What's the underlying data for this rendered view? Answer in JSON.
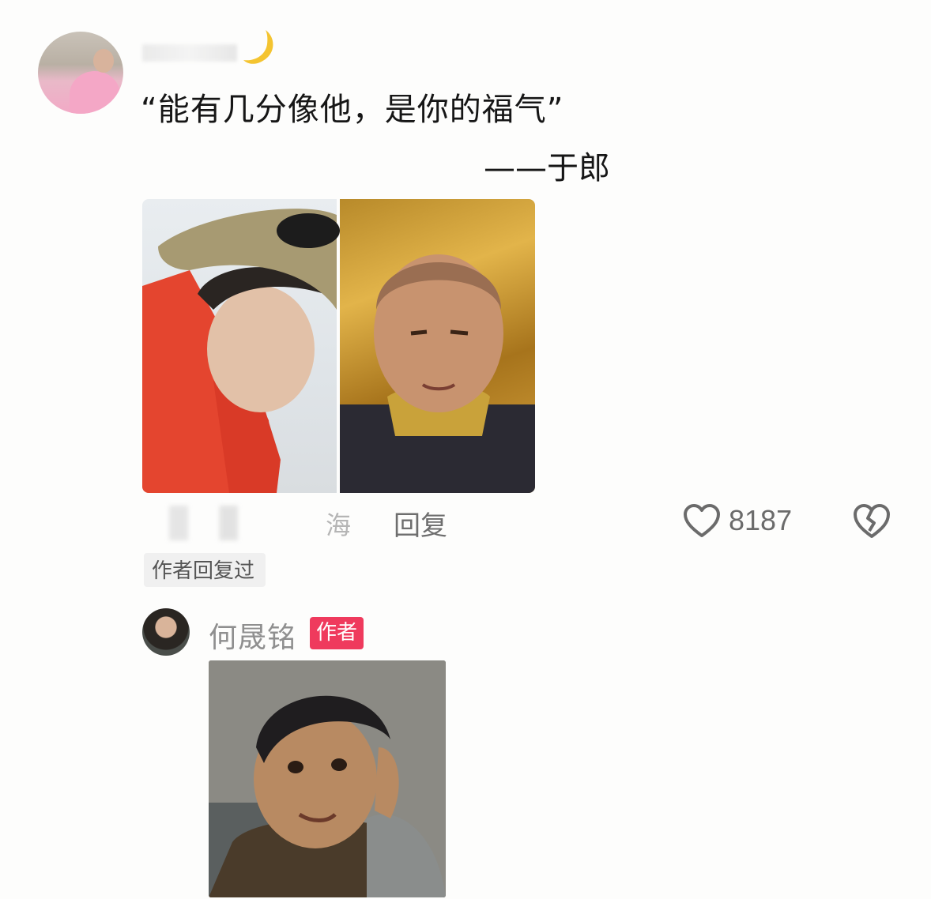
{
  "comment": {
    "quote": "“能有几分像他，是你的福气”",
    "attribution": "——于郎",
    "location": "海",
    "reply_label": "回复",
    "likes": "8187",
    "author_replied": "作者回复过"
  },
  "reply": {
    "author_name": "何晟铭",
    "author_badge": "作者"
  },
  "icons": {
    "like": "heart-outline-icon",
    "dislike": "broken-heart-icon"
  },
  "colors": {
    "badge": "#ef3a5d",
    "muted_text": "#8f8f8f"
  }
}
